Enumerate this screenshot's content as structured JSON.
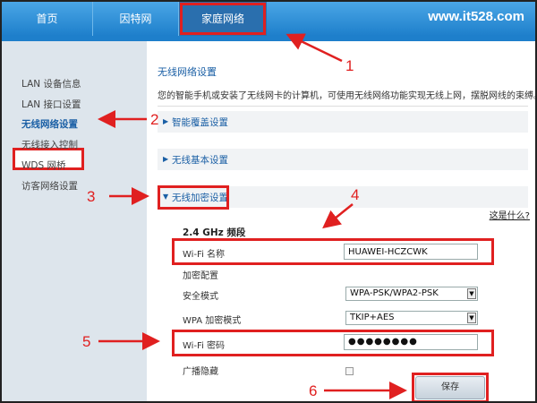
{
  "nav": {
    "tabs": [
      {
        "label": "首页"
      },
      {
        "label": "因特网"
      },
      {
        "label": "家庭网络"
      }
    ],
    "watermark": "www.it528.com"
  },
  "sidebar": {
    "items": [
      {
        "label": "LAN 设备信息"
      },
      {
        "label": "LAN 接口设置"
      },
      {
        "label": "无线网络设置"
      },
      {
        "label": "无线接入控制"
      },
      {
        "label": "WDS 网桥"
      },
      {
        "label": "访客网络设置"
      }
    ]
  },
  "main": {
    "title": "无线网络设置",
    "description": "您的智能手机或安装了无线网卡的计算机，可使用无线网络功能实现无线上网，摆脱网线的束缚。",
    "sections": {
      "smart": "智能覆盖设置",
      "basic": "无线基本设置",
      "encryption": "无线加密设置"
    },
    "help": "这是什么?",
    "band": "2.4 GHz 频段",
    "wifi_name_label": "Wi-Fi 名称",
    "wifi_name_value": "HUAWEI-HCZCWK",
    "encryption_config": "加密配置",
    "security_mode_label": "安全模式",
    "security_mode_value": "WPA-PSK/WPA2-PSK",
    "wpa_mode_label": "WPA 加密模式",
    "wpa_mode_value": "TKIP+AES",
    "wifi_password_label": "Wi-Fi 密码",
    "wifi_password_value": "●●●●●●●●",
    "broadcast_hide_label": "广播隐藏",
    "save_label": "保存"
  },
  "annotations": {
    "steps": [
      "1",
      "2",
      "3",
      "4",
      "5",
      "6"
    ]
  },
  "colors": {
    "nav_blue": "#1e7fcb",
    "highlight_red": "#e02020",
    "link_blue": "#1a5fa5",
    "sidebar_bg": "#dde5ec"
  }
}
